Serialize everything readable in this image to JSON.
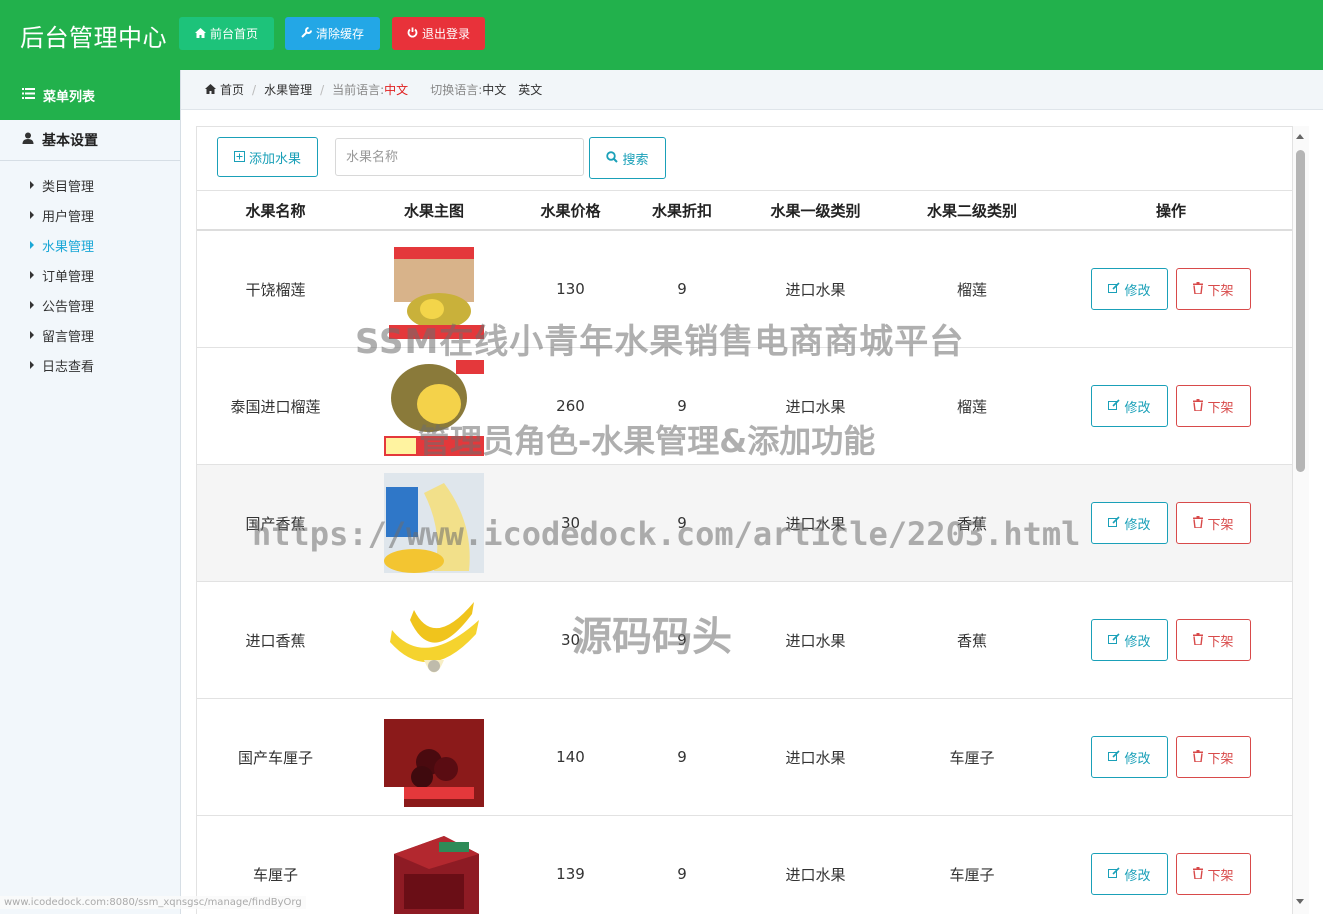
{
  "header": {
    "title": "后台管理中心",
    "buttons": {
      "home": "前台首页",
      "clear_cache": "清除缓存",
      "logout": "退出登录"
    }
  },
  "sidebar": {
    "menu_title": "菜单列表",
    "group": "基本设置",
    "items": [
      {
        "label": "类目管理",
        "active": false
      },
      {
        "label": "用户管理",
        "active": false
      },
      {
        "label": "水果管理",
        "active": true
      },
      {
        "label": "订单管理",
        "active": false
      },
      {
        "label": "公告管理",
        "active": false
      },
      {
        "label": "留言管理",
        "active": false
      },
      {
        "label": "日志查看",
        "active": false
      }
    ]
  },
  "breadcrumb": {
    "home": "首页",
    "current": "水果管理",
    "lang_label": "当前语言:",
    "lang_value": "中文",
    "switch_label": "切换语言:",
    "switch_zh": "中文",
    "switch_en": "英文"
  },
  "toolbar": {
    "add_label": "添加水果",
    "search_placeholder": "水果名称",
    "search_label": "搜索"
  },
  "table": {
    "headers": [
      "水果名称",
      "水果主图",
      "水果价格",
      "水果折扣",
      "水果一级类别",
      "水果二级类别",
      "操作"
    ],
    "edit_label": "修改",
    "remove_label": "下架",
    "rows": [
      {
        "name": "干饶榴莲",
        "price": "130",
        "discount": "9",
        "cat1": "进口水果",
        "cat2": "榴莲"
      },
      {
        "name": "泰国进口榴莲",
        "price": "260",
        "discount": "9",
        "cat1": "进口水果",
        "cat2": "榴莲"
      },
      {
        "name": "国产香蕉",
        "price": "30",
        "discount": "9",
        "cat1": "进口水果",
        "cat2": "香蕉"
      },
      {
        "name": "进口香蕉",
        "price": "30",
        "discount": "9",
        "cat1": "进口水果",
        "cat2": "香蕉"
      },
      {
        "name": "国产车厘子",
        "price": "140",
        "discount": "9",
        "cat1": "进口水果",
        "cat2": "车厘子"
      },
      {
        "name": "车厘子",
        "price": "139",
        "discount": "9",
        "cat1": "进口水果",
        "cat2": "车厘子"
      }
    ]
  },
  "watermarks": {
    "line1": "SSM在线小青年水果销售电商商城平台",
    "line2": "管理员角色-水果管理&添加功能",
    "line3": "https://www.icodedock.com/article/2203.html",
    "line4": "源码码头"
  },
  "status_url": "www.icodedock.com:8080/ssm_xqnsgsc/manage/findByOrg"
}
